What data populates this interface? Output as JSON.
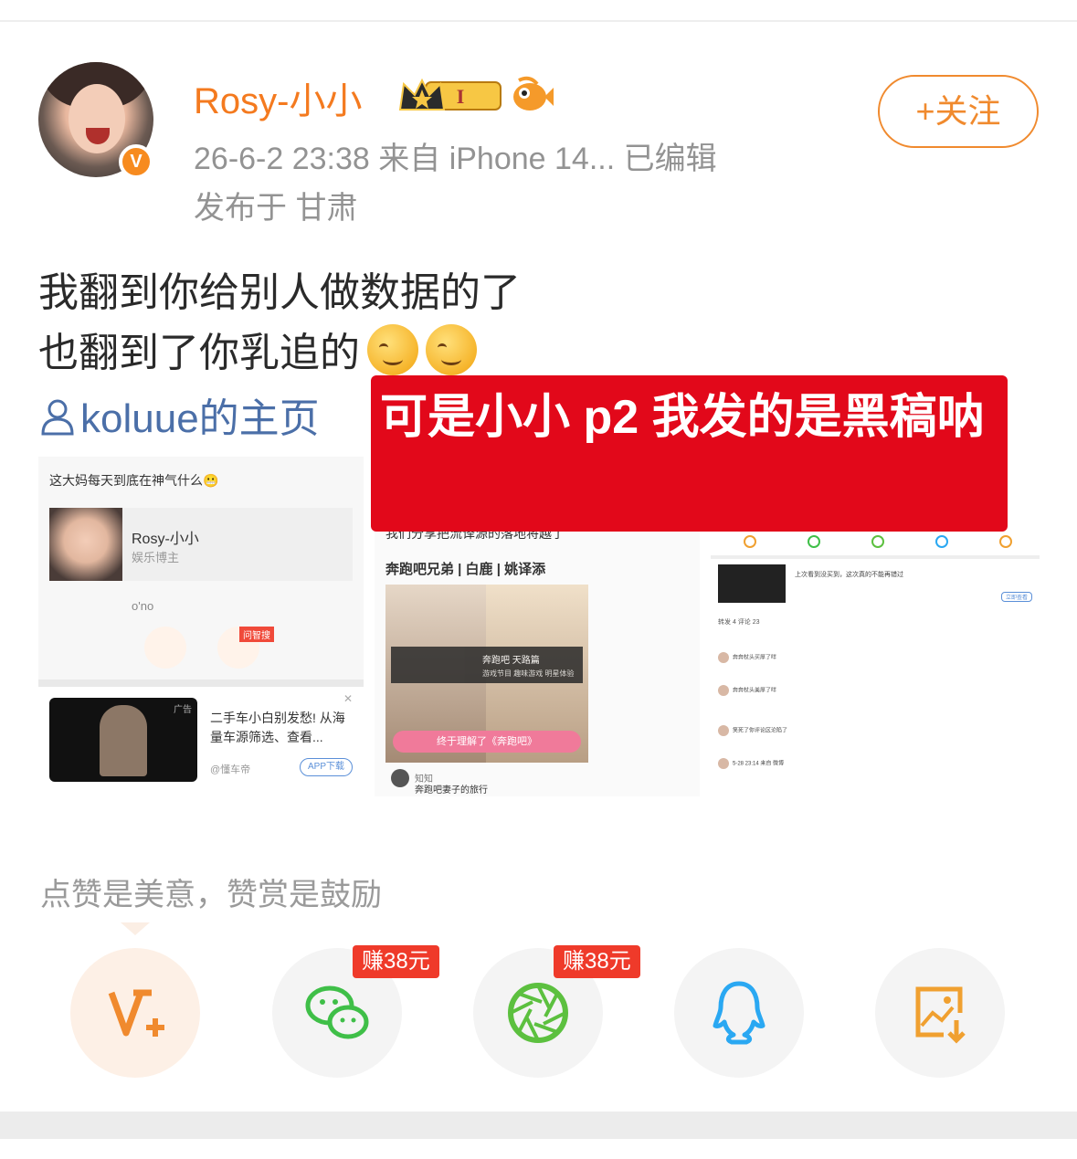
{
  "post": {
    "username": "Rosy-小小",
    "meta": "26-6-2 23:38  来自 iPhone 14...  已编辑",
    "location": "发布于 甘肃",
    "follow_label": "+关注",
    "content_line1": "我翻到你给别人做数据的了",
    "content_line2": "也翻到了你乳追的",
    "profile_link": "koluue的主页",
    "overlay_text": "可是小小 p2 我发的是黑稿呐"
  },
  "image1": {
    "title": "这大妈每天到底在神气什么😬",
    "card_name": "Rosy-小小",
    "card_sub": "娱乐博主",
    "ono": "o'no",
    "badge": "问智搜",
    "ad_text": "二手车小白别发愁! 从海量车源筛选、查看...",
    "ad_tag": "广告",
    "ad_source": "@懂车帝",
    "ad_button": "APP下载"
  },
  "image2": {
    "trunc_text": "我们分享把流译源的落地将越了",
    "show_title": "奔跑吧兄弟 | 白鹿 | 姚译添",
    "bar_title": "奔跑吧 天路篇",
    "bar_tags": "游戏节目  趣味游戏  明星体验",
    "sub_banner": "终于理解了《奔跑吧》",
    "zhihu_source": "知知",
    "zhihu_title": "奔跑吧妻子的旅行"
  },
  "image3": {
    "mini_text": "上次看到没买到，这次真的不能再错过",
    "mini_button": "立即查看",
    "tabs": "转发 4   评论 23",
    "comments": [
      "奔奔杖头买厚了咩",
      "奔奔杖头美厚了咩",
      "笑死了你评论区沦陷了",
      "5-28 23:14 来自 微博"
    ]
  },
  "reward_hint": "点赞是美意，赞赏是鼓励",
  "share": {
    "earn_label": "赚38元",
    "icons": [
      "vplus-icon",
      "wechat-icon",
      "moments-icon",
      "qq-icon",
      "save-image-icon"
    ],
    "colors": {
      "accent": "#f08a2e",
      "wechat": "#3fbf48",
      "moments": "#5cc03f",
      "qq": "#2aa8f2",
      "save": "#f0a030"
    }
  }
}
